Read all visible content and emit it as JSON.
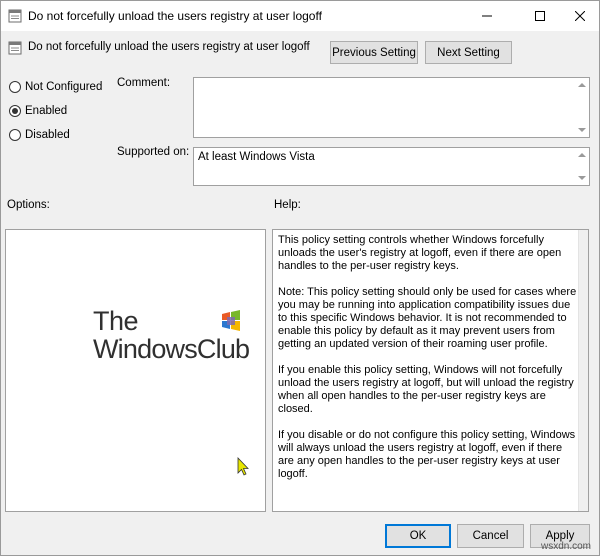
{
  "window": {
    "title": "Do not forcefully unload the users registry at user logoff"
  },
  "header": {
    "policy_name": "Do not forcefully unload the users registry at user logoff",
    "previous_label": "Previous Setting",
    "next_label": "Next Setting"
  },
  "state": {
    "options": [
      {
        "label": "Not Configured",
        "selected": false
      },
      {
        "label": "Enabled",
        "selected": true
      },
      {
        "label": "Disabled",
        "selected": false
      }
    ]
  },
  "comment": {
    "label": "Comment:",
    "value": ""
  },
  "supported": {
    "label": "Supported on:",
    "value": "At least Windows Vista"
  },
  "options_label": "Options:",
  "help_label": "Help:",
  "help_paragraphs": [
    "This policy setting  controls whether Windows forcefully unloads the user's registry at logoff, even if there are open handles to the per-user registry keys.",
    "Note: This policy setting should only be used for cases where you may be running into application compatibility issues due to this specific Windows behavior. It is not recommended to enable this policy by default as it may prevent users from getting an updated version of their roaming user profile.",
    "If you enable this policy setting, Windows will not forcefully unload the users registry at logoff, but will unload the registry when all open handles to the per-user registry keys are closed.",
    "If you disable or do not configure this policy setting, Windows will always unload the users registry at logoff, even if there are any open handles to the per-user registry keys at user logoff."
  ],
  "logo": {
    "line1": "The",
    "line2": "WindowsClub"
  },
  "footer": {
    "ok_label": "OK",
    "cancel_label": "Cancel",
    "apply_label": "Apply"
  },
  "watermark": "wsxdn.com",
  "icons": {
    "app": "policy-settings-icon",
    "minimize": "minimize-icon",
    "maximize": "maximize-icon",
    "close": "close-icon"
  },
  "colors": {
    "accent": "#0078d7",
    "dialog_bg": "#f0f0f0"
  }
}
